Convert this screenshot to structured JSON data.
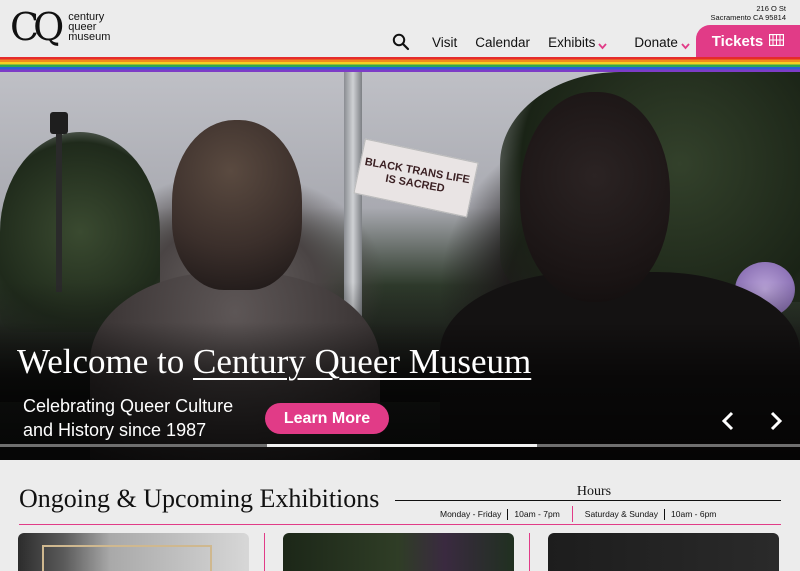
{
  "header": {
    "logo_mark": "CQ",
    "logo_text": "century queer museum",
    "address_line1": "216 O St",
    "address_line2": "Sacramento CA 95814",
    "nav": [
      {
        "label": "Visit",
        "has_dropdown": false
      },
      {
        "label": "Calendar",
        "has_dropdown": false
      },
      {
        "label": "Exhibits",
        "has_dropdown": true
      },
      {
        "label": "Donate",
        "has_dropdown": true
      }
    ],
    "tickets_label": "Tickets"
  },
  "hero": {
    "title_prefix": "Welcome to ",
    "title_link": "Century Queer Museum",
    "subtitle_line1": "Celebrating Queer Culture",
    "subtitle_line2": "and History since 1987",
    "cta_label": "Learn More",
    "sign_text": "BLACK TRANS LIFE IS SACRED"
  },
  "exhibitions": {
    "title": "Ongoing & Upcoming Exhibitions"
  },
  "hours": {
    "label": "Hours",
    "weekday_days": "Monday - Friday",
    "weekday_time": "10am - 7pm",
    "weekend_days": "Saturday & Sunday",
    "weekend_time": "10am - 6pm"
  },
  "colors": {
    "accent": "#e13b87",
    "background": "#ececec",
    "text": "#111111"
  }
}
